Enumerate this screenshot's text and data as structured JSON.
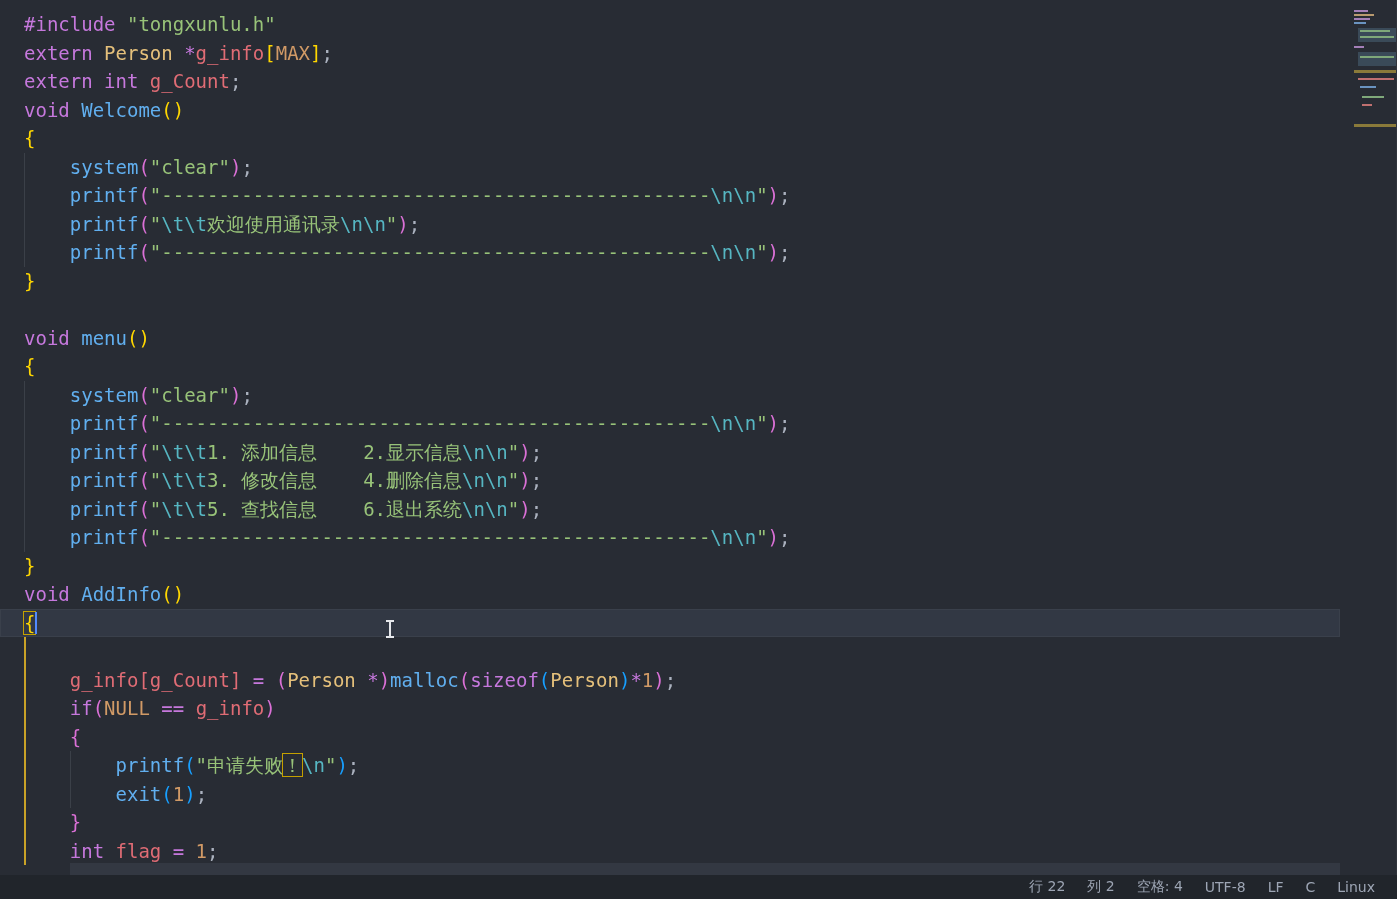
{
  "editor": {
    "lines": [
      {
        "current": false,
        "active_scope": false,
        "tokens": [
          {
            "kind": "kw",
            "text": "#include "
          },
          {
            "kind": "str",
            "text": "\"tongxunlu.h\""
          }
        ]
      },
      {
        "current": false,
        "active_scope": false,
        "tokens": [
          {
            "kind": "kw",
            "text": "extern "
          },
          {
            "kind": "type",
            "text": "Person "
          },
          {
            "kind": "op",
            "text": "*"
          },
          {
            "kind": "var",
            "text": "g_info"
          },
          {
            "kind": "b1",
            "text": "["
          },
          {
            "kind": "num",
            "text": "MAX"
          },
          {
            "kind": "b1",
            "text": "]"
          },
          {
            "kind": "punct",
            "text": ";"
          }
        ]
      },
      {
        "current": false,
        "active_scope": false,
        "tokens": [
          {
            "kind": "kw",
            "text": "extern int "
          },
          {
            "kind": "var",
            "text": "g_Count"
          },
          {
            "kind": "punct",
            "text": ";"
          }
        ]
      },
      {
        "current": false,
        "active_scope": false,
        "tokens": [
          {
            "kind": "kw",
            "text": "void "
          },
          {
            "kind": "fn",
            "text": "Welcome"
          },
          {
            "kind": "b1",
            "text": "()"
          }
        ]
      },
      {
        "current": false,
        "active_scope": false,
        "tokens": [
          {
            "kind": "b1",
            "text": "{"
          }
        ]
      },
      {
        "current": false,
        "active_scope": false,
        "tokens": [
          {
            "kind": "fn",
            "text": "    system"
          },
          {
            "kind": "b2",
            "text": "("
          },
          {
            "kind": "str",
            "text": "\"clear\""
          },
          {
            "kind": "b2",
            "text": ")"
          },
          {
            "kind": "punct",
            "text": ";"
          }
        ]
      },
      {
        "current": false,
        "active_scope": false,
        "tokens": [
          {
            "kind": "fn",
            "text": "    printf"
          },
          {
            "kind": "b2",
            "text": "("
          },
          {
            "kind": "str",
            "text": "\"------------------------------------------------"
          },
          {
            "kind": "esc",
            "text": "\\n\\n"
          },
          {
            "kind": "str",
            "text": "\""
          },
          {
            "kind": "b2",
            "text": ")"
          },
          {
            "kind": "punct",
            "text": ";"
          }
        ]
      },
      {
        "current": false,
        "active_scope": false,
        "tokens": [
          {
            "kind": "fn",
            "text": "    printf"
          },
          {
            "kind": "b2",
            "text": "("
          },
          {
            "kind": "str",
            "text": "\""
          },
          {
            "kind": "esc",
            "text": "\\t\\t"
          },
          {
            "kind": "str",
            "text": "欢迎使用通讯录"
          },
          {
            "kind": "esc",
            "text": "\\n\\n"
          },
          {
            "kind": "str",
            "text": "\""
          },
          {
            "kind": "b2",
            "text": ")"
          },
          {
            "kind": "punct",
            "text": ";"
          }
        ]
      },
      {
        "current": false,
        "active_scope": false,
        "tokens": [
          {
            "kind": "fn",
            "text": "    printf"
          },
          {
            "kind": "b2",
            "text": "("
          },
          {
            "kind": "str",
            "text": "\"------------------------------------------------"
          },
          {
            "kind": "esc",
            "text": "\\n\\n"
          },
          {
            "kind": "str",
            "text": "\""
          },
          {
            "kind": "b2",
            "text": ")"
          },
          {
            "kind": "punct",
            "text": ";"
          }
        ]
      },
      {
        "current": false,
        "active_scope": false,
        "tokens": [
          {
            "kind": "b1",
            "text": "}"
          }
        ]
      },
      {
        "current": false,
        "active_scope": false
      },
      {
        "current": false,
        "active_scope": false,
        "tokens": [
          {
            "kind": "kw",
            "text": "void "
          },
          {
            "kind": "fn",
            "text": "menu"
          },
          {
            "kind": "b1",
            "text": "()"
          }
        ]
      },
      {
        "current": false,
        "active_scope": false,
        "tokens": [
          {
            "kind": "b1",
            "text": "{"
          }
        ]
      },
      {
        "current": false,
        "active_scope": false,
        "tokens": [
          {
            "kind": "fn",
            "text": "    system"
          },
          {
            "kind": "b2",
            "text": "("
          },
          {
            "kind": "str",
            "text": "\"clear\""
          },
          {
            "kind": "b2",
            "text": ")"
          },
          {
            "kind": "punct",
            "text": ";"
          }
        ]
      },
      {
        "current": false,
        "active_scope": false,
        "tokens": [
          {
            "kind": "fn",
            "text": "    printf"
          },
          {
            "kind": "b2",
            "text": "("
          },
          {
            "kind": "str",
            "text": "\"------------------------------------------------"
          },
          {
            "kind": "esc",
            "text": "\\n\\n"
          },
          {
            "kind": "str",
            "text": "\""
          },
          {
            "kind": "b2",
            "text": ")"
          },
          {
            "kind": "punct",
            "text": ";"
          }
        ]
      },
      {
        "current": false,
        "active_scope": false,
        "tokens": [
          {
            "kind": "fn",
            "text": "    printf"
          },
          {
            "kind": "b2",
            "text": "("
          },
          {
            "kind": "str",
            "text": "\""
          },
          {
            "kind": "esc",
            "text": "\\t\\t"
          },
          {
            "kind": "str",
            "text": "1. 添加信息    2.显示信息"
          },
          {
            "kind": "esc",
            "text": "\\n\\n"
          },
          {
            "kind": "str",
            "text": "\""
          },
          {
            "kind": "b2",
            "text": ")"
          },
          {
            "kind": "punct",
            "text": ";"
          }
        ]
      },
      {
        "current": false,
        "active_scope": false,
        "tokens": [
          {
            "kind": "fn",
            "text": "    printf"
          },
          {
            "kind": "b2",
            "text": "("
          },
          {
            "kind": "str",
            "text": "\""
          },
          {
            "kind": "esc",
            "text": "\\t\\t"
          },
          {
            "kind": "str",
            "text": "3. 修改信息    4.删除信息"
          },
          {
            "kind": "esc",
            "text": "\\n\\n"
          },
          {
            "kind": "str",
            "text": "\""
          },
          {
            "kind": "b2",
            "text": ")"
          },
          {
            "kind": "punct",
            "text": ";"
          }
        ]
      },
      {
        "current": false,
        "active_scope": false,
        "tokens": [
          {
            "kind": "fn",
            "text": "    printf"
          },
          {
            "kind": "b2",
            "text": "("
          },
          {
            "kind": "str",
            "text": "\""
          },
          {
            "kind": "esc",
            "text": "\\t\\t"
          },
          {
            "kind": "str",
            "text": "5. 查找信息    6.退出系统"
          },
          {
            "kind": "esc",
            "text": "\\n\\n"
          },
          {
            "kind": "str",
            "text": "\""
          },
          {
            "kind": "b2",
            "text": ")"
          },
          {
            "kind": "punct",
            "text": ";"
          }
        ]
      },
      {
        "current": false,
        "active_scope": false,
        "tokens": [
          {
            "kind": "fn",
            "text": "    printf"
          },
          {
            "kind": "b2",
            "text": "("
          },
          {
            "kind": "str",
            "text": "\"------------------------------------------------"
          },
          {
            "kind": "esc",
            "text": "\\n\\n"
          },
          {
            "kind": "str",
            "text": "\""
          },
          {
            "kind": "b2",
            "text": ")"
          },
          {
            "kind": "punct",
            "text": ";"
          }
        ]
      },
      {
        "current": false,
        "active_scope": false,
        "tokens": [
          {
            "kind": "b1",
            "text": "}"
          }
        ]
      },
      {
        "current": false,
        "active_scope": false,
        "tokens": [
          {
            "kind": "kw",
            "text": "void "
          },
          {
            "kind": "fn",
            "text": "AddInfo"
          },
          {
            "kind": "b1",
            "text": "()"
          }
        ]
      },
      {
        "current": true,
        "active_scope": false,
        "tokens": [
          {
            "kind": "match",
            "text": "{"
          }
        ]
      },
      {
        "current": false,
        "active_scope": true
      },
      {
        "current": false,
        "active_scope": true,
        "tokens": [
          {
            "kind": "var",
            "text": "    g_info[g_Count]"
          },
          {
            "kind": "op",
            "text": " = "
          },
          {
            "kind": "b2",
            "text": "("
          },
          {
            "kind": "type",
            "text": "Person "
          },
          {
            "kind": "op",
            "text": "*"
          },
          {
            "kind": "b2",
            "text": ")"
          },
          {
            "kind": "fn",
            "text": "malloc"
          },
          {
            "kind": "b2",
            "text": "("
          },
          {
            "kind": "kw",
            "text": "sizeof"
          },
          {
            "kind": "b3",
            "text": "("
          },
          {
            "kind": "type",
            "text": "Person"
          },
          {
            "kind": "b3",
            "text": ")"
          },
          {
            "kind": "op",
            "text": "*"
          },
          {
            "kind": "num",
            "text": "1"
          },
          {
            "kind": "b2",
            "text": ")"
          },
          {
            "kind": "punct",
            "text": ";"
          }
        ]
      },
      {
        "current": false,
        "active_scope": true,
        "tokens": [
          {
            "kind": "kw",
            "text": "    if"
          },
          {
            "kind": "b2",
            "text": "("
          },
          {
            "kind": "num",
            "text": "NULL"
          },
          {
            "kind": "op",
            "text": " == "
          },
          {
            "kind": "var",
            "text": "g_info"
          },
          {
            "kind": "b2",
            "text": ")"
          }
        ]
      },
      {
        "current": false,
        "active_scope": true,
        "tokens": [
          {
            "kind": "b2",
            "text": "    {"
          }
        ]
      },
      {
        "current": false,
        "active_scope": true,
        "tokens": [
          {
            "kind": "fn",
            "text": "        printf"
          },
          {
            "kind": "b3",
            "text": "("
          },
          {
            "kind": "str",
            "text": "\"申请失败"
          },
          {
            "kind": "strbox",
            "text": "！"
          },
          {
            "kind": "esc",
            "text": "\\n"
          },
          {
            "kind": "str",
            "text": "\""
          },
          {
            "kind": "b3",
            "text": ")"
          },
          {
            "kind": "punct",
            "text": ";"
          }
        ]
      },
      {
        "current": false,
        "active_scope": true,
        "tokens": [
          {
            "kind": "fn",
            "text": "        exit"
          },
          {
            "kind": "b3",
            "text": "("
          },
          {
            "kind": "num",
            "text": "1"
          },
          {
            "kind": "b3",
            "text": ")"
          },
          {
            "kind": "punct",
            "text": ";"
          }
        ]
      },
      {
        "current": false,
        "active_scope": true,
        "tokens": [
          {
            "kind": "b2",
            "text": "    }"
          }
        ]
      },
      {
        "current": false,
        "active_scope": true,
        "tokens": [
          {
            "kind": "kw",
            "text": "    int "
          },
          {
            "kind": "var",
            "text": "flag"
          },
          {
            "kind": "op",
            "text": " = "
          },
          {
            "kind": "num",
            "text": "1"
          },
          {
            "kind": "punct",
            "text": ";"
          }
        ]
      }
    ]
  },
  "status_bar": [
    "行 22",
    "列 2",
    "空格: 4",
    "UTF-8",
    "LF",
    "C",
    "Linux"
  ]
}
